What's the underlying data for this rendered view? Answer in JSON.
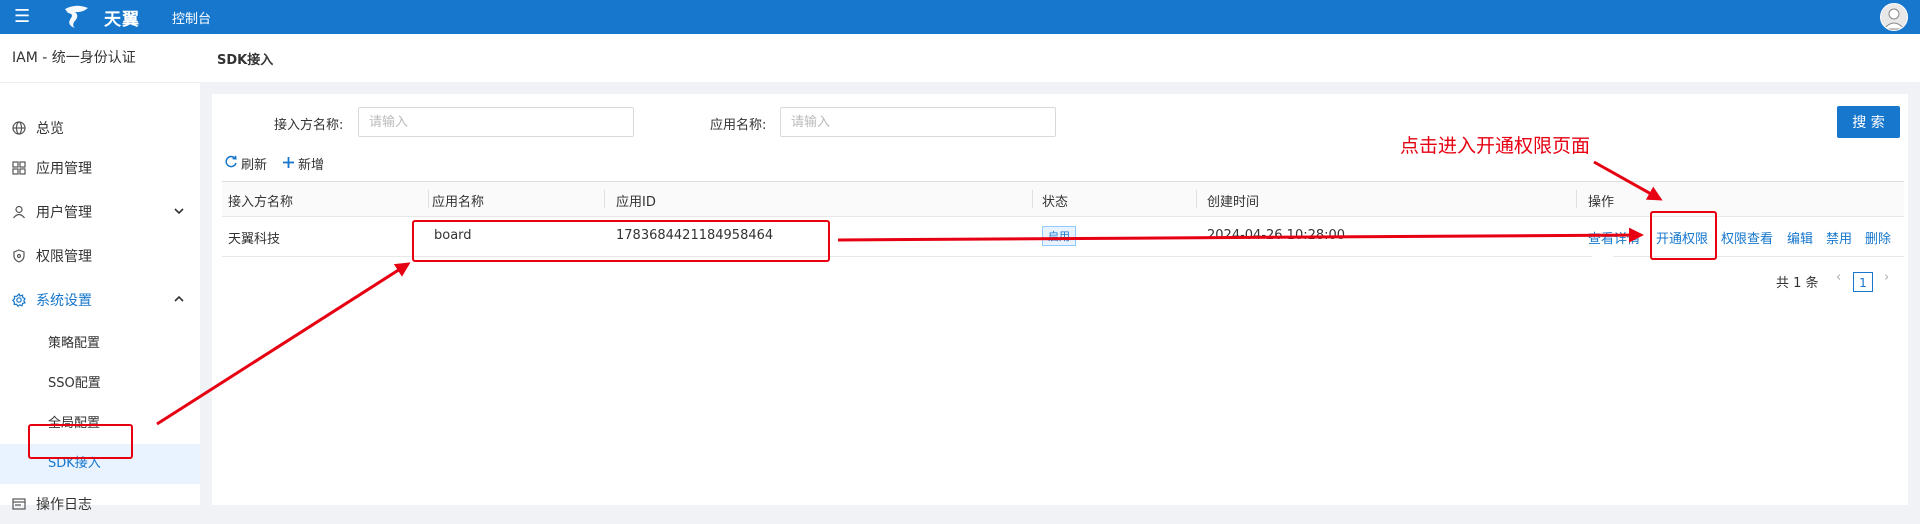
{
  "topbar": {
    "menu_icon": "menu-icon",
    "brand": "天翼",
    "console": "控制台",
    "avatar": "avatar-icon"
  },
  "sidebar": {
    "app_title": "IAM - 统一身份认证",
    "items": [
      {
        "label": "总览",
        "icon": "globe-icon"
      },
      {
        "label": "应用管理",
        "icon": "grid-icon"
      },
      {
        "label": "用户管理",
        "icon": "user-icon",
        "expand": "chevron-down"
      },
      {
        "label": "权限管理",
        "icon": "shield-icon"
      },
      {
        "label": "系统设置",
        "icon": "gear-icon",
        "expand": "chevron-up"
      },
      {
        "label": "操作日志",
        "icon": "log-icon"
      }
    ],
    "sub_items": [
      {
        "label": "策略配置"
      },
      {
        "label": "SSO配置"
      },
      {
        "label": "全局配置"
      },
      {
        "label": "SDK接入",
        "active": true
      }
    ]
  },
  "breadcrumb": "SDK接入",
  "filters": {
    "accessor_label": "接入方名称:",
    "accessor_placeholder": "请输入",
    "app_label": "应用名称:",
    "app_placeholder": "请输入",
    "search_button": "搜 索"
  },
  "toolbar": {
    "refresh": "刷新",
    "add": "新增"
  },
  "table": {
    "columns": [
      "接入方名称",
      "应用名称",
      "应用ID",
      "状态",
      "创建时间",
      "操作"
    ],
    "rows": [
      {
        "accessor": "天翼科技",
        "app_name": "board",
        "app_id": "1783684421184958464",
        "status": "启用",
        "created": "2024-04-26 10:28:00",
        "actions": [
          "查看详情",
          "开通权限",
          "权限查看",
          "编辑",
          "禁用",
          "删除"
        ]
      }
    ]
  },
  "pagination": {
    "total": "共 1 条",
    "current": "1"
  },
  "annotation": {
    "text": "点击进入开通权限页面",
    "color": "#e60012"
  },
  "colors": {
    "primary": "#1677cc",
    "annotation": "#e60012"
  }
}
